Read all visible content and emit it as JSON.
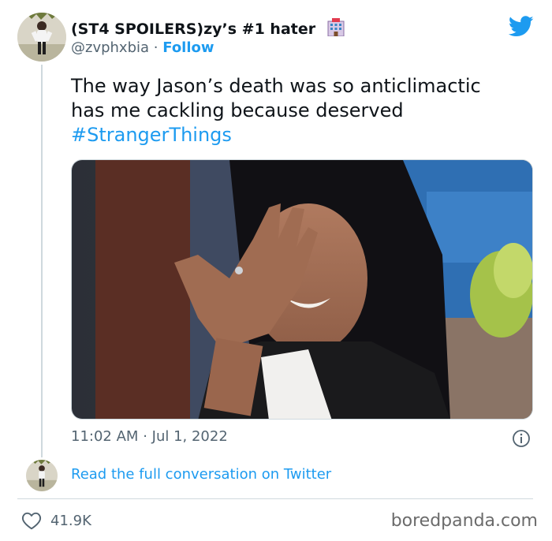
{
  "tweet": {
    "display_name": "(ST4 SPOILERS)zy’s #1 hater",
    "handle": "@zvphxbia",
    "separator": "·",
    "follow_label": "Follow",
    "text_line1": "The way Jason’s death was so anticlimactic",
    "text_line2": "has me cackling because deserved",
    "hashtag": "#StrangerThings",
    "time": "11:02 AM",
    "date": "Jul 1, 2022",
    "read_conversation_label": "Read the full conversation on Twitter",
    "like_count": "41.9K"
  },
  "icons": {
    "emoji": "hotel-emoji",
    "brand": "twitter-bird-icon",
    "info": "info-icon",
    "like": "heart-icon"
  },
  "colors": {
    "accent": "#1d9bf0",
    "text": "#0f1419",
    "secondary": "#536471",
    "border": "#cfd9de"
  },
  "watermark": "boredpanda.com"
}
